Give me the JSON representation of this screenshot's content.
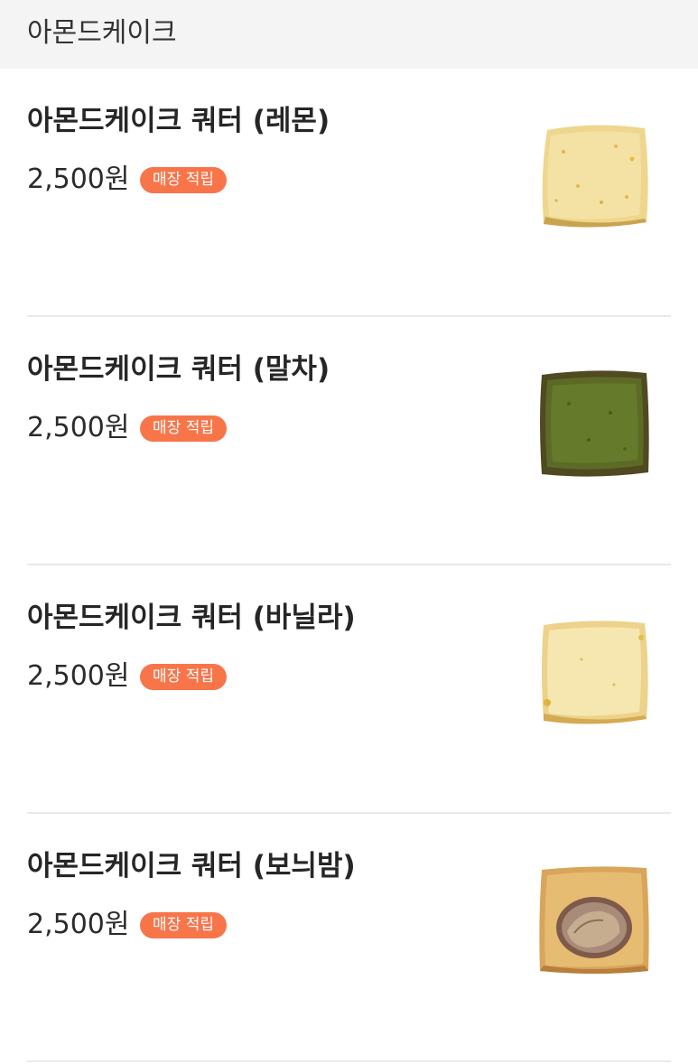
{
  "category": {
    "title": "아몬드케이크"
  },
  "badge_color": "#f8754a",
  "items": [
    {
      "name": "아몬드케이크 쿼터 (레몬)",
      "price": "2,500원",
      "badge": "매장 적립",
      "thumbnail": "lemon-cake-thumbnail"
    },
    {
      "name": "아몬드케이크 쿼터 (말차)",
      "price": "2,500원",
      "badge": "매장 적립",
      "thumbnail": "matcha-cake-thumbnail"
    },
    {
      "name": "아몬드케이크 쿼터 (바닐라)",
      "price": "2,500원",
      "badge": "매장 적립",
      "thumbnail": "vanilla-cake-thumbnail"
    },
    {
      "name": "아몬드케이크 쿼터 (보늬밤)",
      "price": "2,500원",
      "badge": "매장 적립",
      "thumbnail": "chestnut-cake-thumbnail"
    }
  ]
}
